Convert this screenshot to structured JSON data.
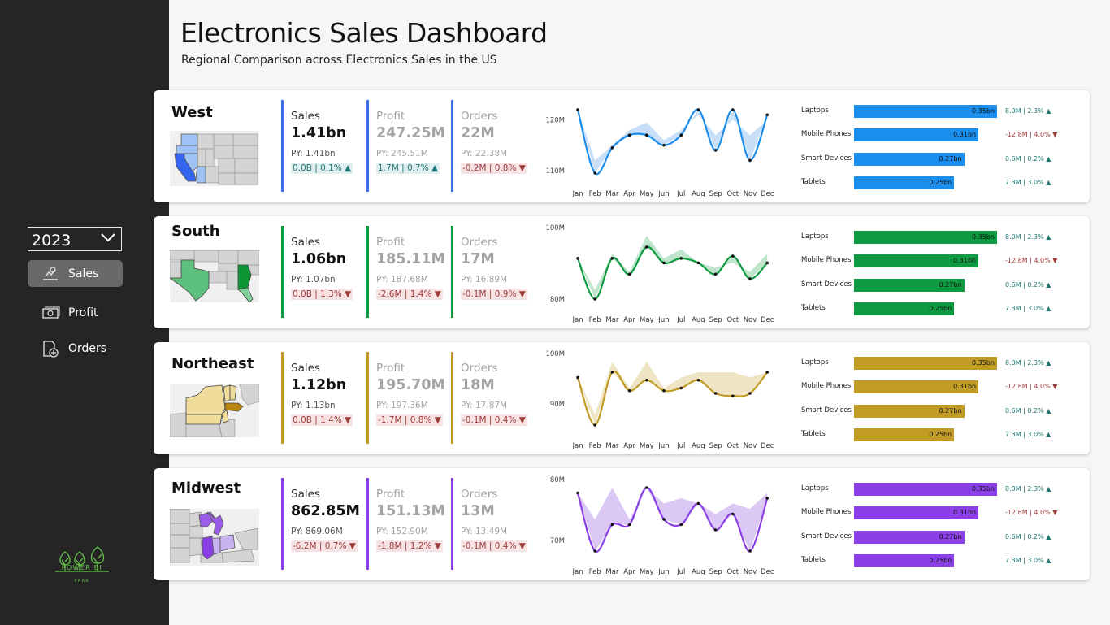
{
  "sidebar": {
    "year": "2023",
    "nav": [
      {
        "label": "Sales",
        "icon": "sales-icon"
      },
      {
        "label": "Profit",
        "icon": "profit-icon"
      },
      {
        "label": "Orders",
        "icon": "orders-icon"
      }
    ],
    "logo_text": "POWER BI",
    "logo_sub": "PARK"
  },
  "header": {
    "title": "Electronics Sales Dashboard",
    "subtitle": "Regional Comparison across Electronics Sales in the US"
  },
  "regions": [
    {
      "name": "West",
      "color": "#1a8ded",
      "band_color": "#c9dff7",
      "kpis": [
        {
          "label": "Sales",
          "value": "1.41bn",
          "py": "PY: 1.41bn",
          "delta": "0.0B | 0.1%",
          "dir": "up"
        },
        {
          "label": "Profit",
          "value": "247.25M",
          "py": "PY: 245.51M",
          "delta": "1.7M | 0.7%",
          "dir": "up"
        },
        {
          "label": "Orders",
          "value": "22M",
          "py": "PY: 22.38M",
          "delta": "-0.2M | 0.8%",
          "dir": "down"
        }
      ],
      "chart_data": {
        "type": "line",
        "x": [
          "Jan",
          "Feb",
          "Mar",
          "Apr",
          "May",
          "Jun",
          "Jul",
          "Aug",
          "Sep",
          "Oct",
          "Nov",
          "Dec"
        ],
        "yticks": [
          "120M",
          "110M"
        ],
        "series": [
          {
            "values": [
              122,
              109.5,
              114.5,
              117,
              117,
              115,
              117,
              122,
              114,
              122,
              112,
              121
            ]
          }
        ],
        "py_values": [
          122,
          112,
          115,
          118,
          119.5,
          116,
          118,
          121,
          117,
          120,
          117,
          120
        ]
      },
      "bars": [
        {
          "label": "Laptops",
          "value": "0.35bn",
          "frac": 1.0,
          "delta": "8.0M | 2.3%",
          "dir": "up"
        },
        {
          "label": "Mobile Phones",
          "value": "0.31bn",
          "frac": 0.87,
          "delta": "-12.8M | 4.0%",
          "dir": "down"
        },
        {
          "label": "Smart Devices",
          "value": "0.27bn",
          "frac": 0.77,
          "delta": "0.6M | 0.2%",
          "dir": "up"
        },
        {
          "label": "Tablets",
          "value": "0.25bn",
          "frac": 0.7,
          "delta": "7.3M | 3.0%",
          "dir": "up"
        }
      ]
    },
    {
      "name": "South",
      "color": "#0e9a41",
      "band_color": "#bfe6cc",
      "kpis": [
        {
          "label": "Sales",
          "value": "1.06bn",
          "py": "PY: 1.07bn",
          "delta": "0.0B | 1.3%",
          "dir": "down"
        },
        {
          "label": "Profit",
          "value": "185.11M",
          "py": "PY: 187.68M",
          "delta": "-2.6M | 1.4%",
          "dir": "down"
        },
        {
          "label": "Orders",
          "value": "17M",
          "py": "PY: 16.89M",
          "delta": "-0.1M | 0.9%",
          "dir": "down"
        }
      ],
      "chart_data": {
        "type": "line",
        "x": [
          "Jan",
          "Feb",
          "Mar",
          "Apr",
          "May",
          "Jun",
          "Jul",
          "Aug",
          "Sep",
          "Oct",
          "Nov",
          "Dec"
        ],
        "yticks": [
          "100M",
          "80M"
        ],
        "series": [
          {
            "values": [
              89,
              80,
              89,
              85.5,
              91.5,
              88,
              89,
              88,
              85.5,
              89.5,
              84.5,
              88
            ]
          }
        ],
        "py_values": [
          89,
          82,
          90,
          86,
          94,
          89,
          91,
          88,
          87,
          88,
          86,
          90
        ]
      },
      "bars": [
        {
          "label": "Laptops",
          "value": "0.35bn",
          "frac": 1.0,
          "delta": "8.0M | 2.3%",
          "dir": "up"
        },
        {
          "label": "Mobile Phones",
          "value": "0.31bn",
          "frac": 0.87,
          "delta": "-12.8M | 4.0%",
          "dir": "down"
        },
        {
          "label": "Smart Devices",
          "value": "0.27bn",
          "frac": 0.77,
          "delta": "0.6M | 0.2%",
          "dir": "up"
        },
        {
          "label": "Tablets",
          "value": "0.25bn",
          "frac": 0.7,
          "delta": "7.3M | 3.0%",
          "dir": "up"
        }
      ]
    },
    {
      "name": "Northeast",
      "color": "#c09b25",
      "band_color": "#efe4c4",
      "kpis": [
        {
          "label": "Sales",
          "value": "1.12bn",
          "py": "PY: 1.13bn",
          "delta": "0.0B | 1.4%",
          "dir": "down"
        },
        {
          "label": "Profit",
          "value": "195.70M",
          "py": "PY: 197.36M",
          "delta": "-1.7M | 0.8%",
          "dir": "down"
        },
        {
          "label": "Orders",
          "value": "18M",
          "py": "PY: 17.87M",
          "delta": "-0.1M | 0.4%",
          "dir": "down"
        }
      ],
      "chart_data": {
        "type": "line",
        "x": [
          "Jan",
          "Feb",
          "Mar",
          "Apr",
          "May",
          "Jun",
          "Jul",
          "Aug",
          "Sep",
          "Oct",
          "Nov",
          "Dec"
        ],
        "yticks": [
          "100M",
          "90M"
        ],
        "series": [
          {
            "values": [
              95,
              86,
              96,
              92.5,
              94.5,
              92.5,
              93,
              94.5,
              92,
              91.5,
              92,
              96
            ]
          }
        ],
        "py_values": [
          95,
          88,
          98,
          93,
          98,
          93,
          95,
          96,
          96,
          96,
          95,
          96
        ]
      },
      "bars": [
        {
          "label": "Laptops",
          "value": "0.35bn",
          "frac": 1.0,
          "delta": "8.0M | 2.3%",
          "dir": "up"
        },
        {
          "label": "Mobile Phones",
          "value": "0.31bn",
          "frac": 0.87,
          "delta": "-12.8M | 4.0%",
          "dir": "down"
        },
        {
          "label": "Smart Devices",
          "value": "0.27bn",
          "frac": 0.77,
          "delta": "0.6M | 0.2%",
          "dir": "up"
        },
        {
          "label": "Tablets",
          "value": "0.25bn",
          "frac": 0.7,
          "delta": "7.3M | 3.0%",
          "dir": "up"
        }
      ]
    },
    {
      "name": "Midwest",
      "color": "#8a40e6",
      "band_color": "#dcc8f5",
      "kpis": [
        {
          "label": "Sales",
          "value": "862.85M",
          "py": "PY: 869.06M",
          "delta": "-6.2M | 0.7%",
          "dir": "down"
        },
        {
          "label": "Profit",
          "value": "151.13M",
          "py": "PY: 152.90M",
          "delta": "-1.8M | 1.2%",
          "dir": "down"
        },
        {
          "label": "Orders",
          "value": "13M",
          "py": "PY: 13.49M",
          "delta": "-0.1M | 0.4%",
          "dir": "down"
        }
      ],
      "chart_data": {
        "type": "line",
        "x": [
          "Jan",
          "Feb",
          "Mar",
          "Apr",
          "May",
          "Jun",
          "Jul",
          "Aug",
          "Sep",
          "Oct",
          "Nov",
          "Dec"
        ],
        "yticks": [
          "80M",
          "70M"
        ],
        "series": [
          {
            "values": [
              74.5,
              69,
              71.5,
              71.5,
              75,
              72,
              71.5,
              73.5,
              71,
              72.5,
              69,
              74
            ]
          }
        ],
        "py_values": [
          74.5,
          72,
          75,
          72,
          75,
          73.5,
          74,
          73.5,
          72.5,
          73.5,
          73,
          74.5
        ]
      },
      "bars": [
        {
          "label": "Laptops",
          "value": "0.35bn",
          "frac": 1.0,
          "delta": "8.0M | 2.3%",
          "dir": "up"
        },
        {
          "label": "Mobile Phones",
          "value": "0.31bn",
          "frac": 0.87,
          "delta": "-12.8M | 4.0%",
          "dir": "down"
        },
        {
          "label": "Smart Devices",
          "value": "0.27bn",
          "frac": 0.77,
          "delta": "0.6M | 0.2%",
          "dir": "up"
        },
        {
          "label": "Tablets",
          "value": "0.25bn",
          "frac": 0.7,
          "delta": "7.3M | 3.0%",
          "dir": "up"
        }
      ]
    }
  ]
}
